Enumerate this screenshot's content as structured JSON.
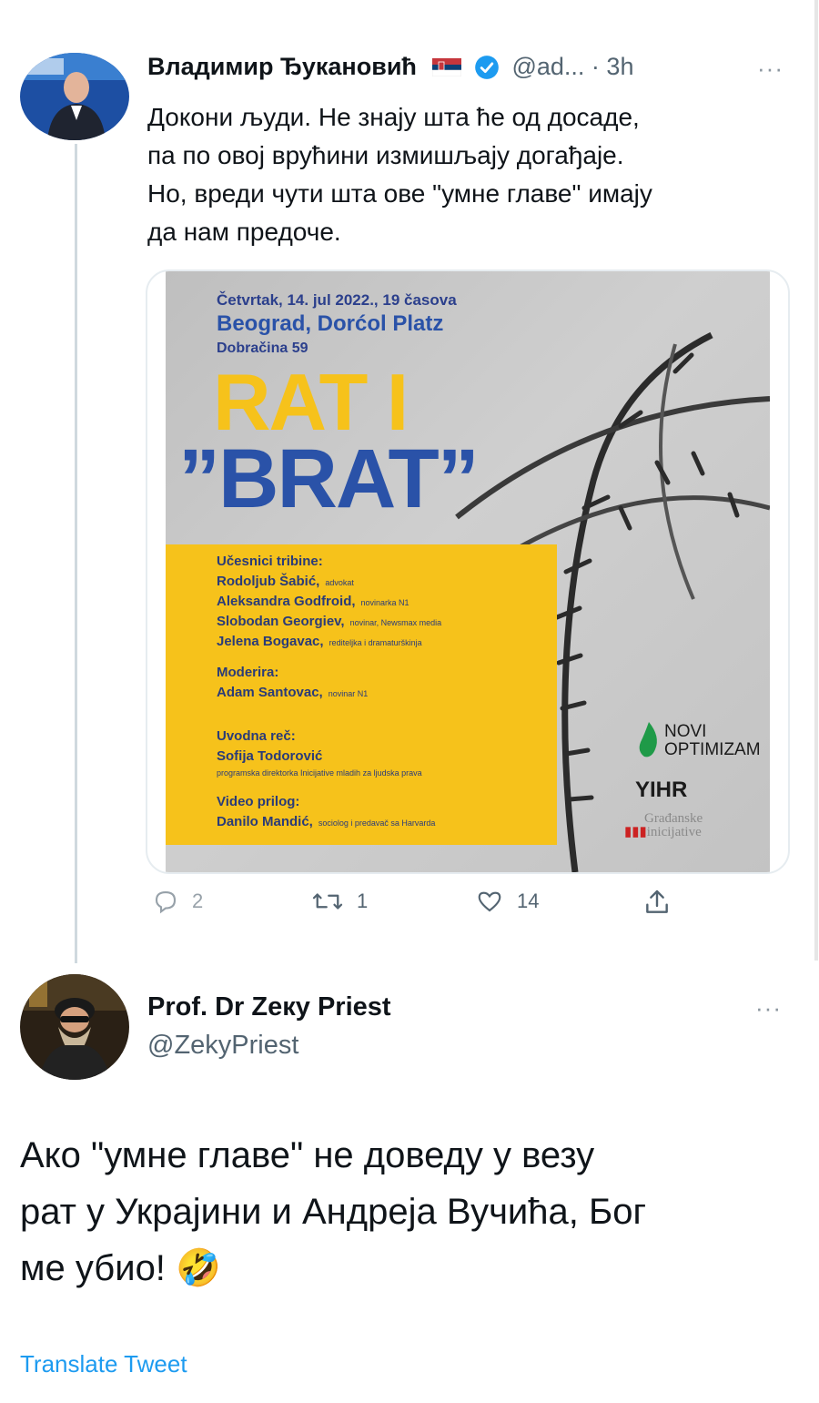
{
  "tweet1": {
    "author_name": "Владимир Ђукановић",
    "handle": "@ad...",
    "time": "3h",
    "more": "···",
    "text_lines": [
      "Докони људи. Не знају шта ће од досаде,",
      "па по овој врућини измишљају догађаје.",
      "Но, вреди чути шта ове \"умне главе\" имају",
      "да нам предоче."
    ],
    "poster": {
      "date_line": "Četvrtak, 14. jul 2022., 19 časova",
      "place_line": "Beograd, Dorćol Platz",
      "address_line": "Dobračina 59",
      "title_top": "RAT I",
      "title_bottom": "BRAT",
      "quote_open": "”",
      "quote_close": "”",
      "participants_heading": "Učesnici tribine:",
      "participants": [
        {
          "name": "Rodoljub Šabić,",
          "role": "advokat"
        },
        {
          "name": "Aleksandra Godfroid,",
          "role": "novinarka N1"
        },
        {
          "name": "Slobodan Georgiev,",
          "role": "novinar, Newsmax media"
        },
        {
          "name": "Jelena Bogavac,",
          "role": "rediteljka i dramaturškinja"
        }
      ],
      "moderator_heading": "Moderira:",
      "moderator": {
        "name": "Adam Santovac,",
        "role": "novinar N1"
      },
      "intro_heading": "Uvodna reč:",
      "intro": {
        "name": "Sofija Todorović",
        "role": "programska direktorka Inicijative mladih za ljudska prava"
      },
      "video_heading": "Video prilog:",
      "video": {
        "name": "Danilo Mandić,",
        "role": "sociolog i predavač sa Harvarda"
      },
      "logo1_line1": "NOVI",
      "logo1_line2": "OPTIMIZAM",
      "logo2": "YIHR",
      "logo3_line1": "Građanske",
      "logo3_line2": "inicijative"
    },
    "actions": {
      "replies": "2",
      "retweets": "1",
      "likes": "14"
    }
  },
  "tweet2": {
    "author_name": "Prof. Dr Zeкy Priest",
    "handle": "@ZekyPriest",
    "more": "···",
    "text_lines": [
      "Ако \"умне главе\" не доведу у везу",
      "рат у Украјини и Андреја Вучића, Бог",
      "ме убио!"
    ],
    "emoji": "🤣",
    "translate": "Translate Tweet"
  },
  "colors": {
    "accent": "#1d9bf0",
    "poster_yellow": "#f6c21b",
    "poster_blue": "#2a52a8",
    "secondary_text": "#536471"
  }
}
